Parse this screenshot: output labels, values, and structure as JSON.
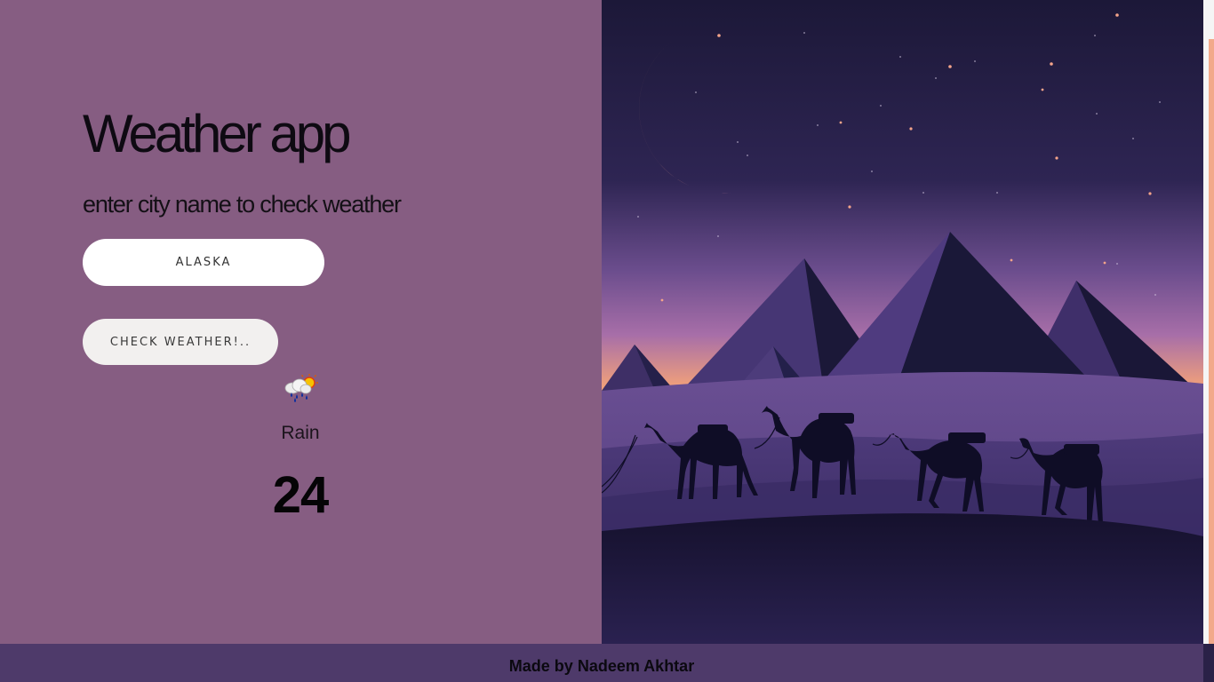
{
  "app": {
    "title": "Weather app",
    "subtitle": "enter city name to check weather"
  },
  "search": {
    "value": "ALASKA",
    "button_label": "CHECK WEATHER!.."
  },
  "result": {
    "icon": "rain-sun-icon",
    "condition": "Rain",
    "temperature": "24"
  },
  "footer": {
    "text": "Made by Nadeem Akhtar"
  },
  "colors": {
    "left_panel": "#865d82",
    "footer": "#4e3a6a",
    "moon": "#f3a071",
    "sky_top": "#1c1838",
    "sky_horizon": "#f0a07b"
  }
}
